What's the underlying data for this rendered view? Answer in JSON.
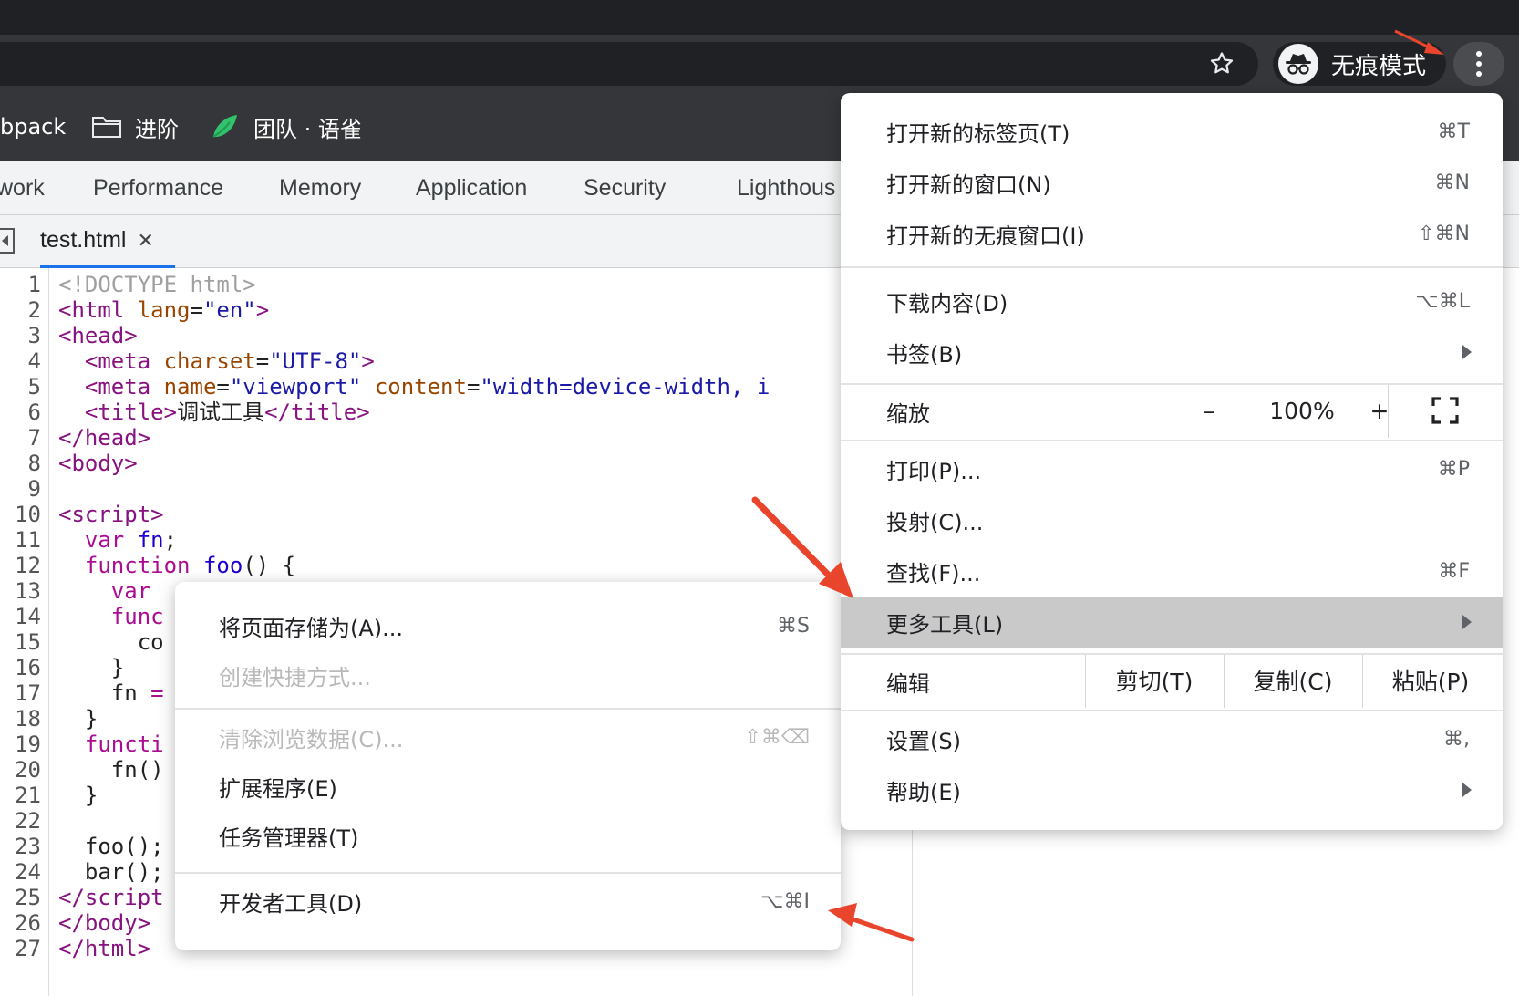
{
  "browser": {
    "incognito_label": "无痕模式",
    "icons": [
      "star-icon",
      "incognito-icon",
      "kebab-menu-icon"
    ]
  },
  "bookmarks": [
    {
      "label": "bpack",
      "icon": ""
    },
    {
      "label": "进阶",
      "icon": "folder-icon"
    },
    {
      "label": "团队 · 语雀",
      "icon": "yuque-logo-icon"
    }
  ],
  "devtools": {
    "tabs": [
      "work",
      "Performance",
      "Memory",
      "Application",
      "Security",
      "Lighthous"
    ],
    "file_tab": "test.html",
    "code_lines": [
      {
        "n": "1",
        "parts": [
          [
            "doc",
            "<!DOCTYPE html>"
          ]
        ]
      },
      {
        "n": "2",
        "parts": [
          [
            "tag",
            "<html "
          ],
          [
            "attr",
            "lang"
          ],
          [
            "plain",
            "="
          ],
          [
            "val",
            "\"en\""
          ],
          [
            "tag",
            ">"
          ]
        ]
      },
      {
        "n": "3",
        "parts": [
          [
            "tag",
            "<head>"
          ]
        ]
      },
      {
        "n": "4",
        "parts": [
          [
            "plain",
            "  "
          ],
          [
            "tag",
            "<meta "
          ],
          [
            "attr",
            "charset"
          ],
          [
            "plain",
            "="
          ],
          [
            "val",
            "\"UTF-8\""
          ],
          [
            "tag",
            ">"
          ]
        ]
      },
      {
        "n": "5",
        "parts": [
          [
            "plain",
            "  "
          ],
          [
            "tag",
            "<meta "
          ],
          [
            "attr",
            "name"
          ],
          [
            "plain",
            "="
          ],
          [
            "val",
            "\"viewport\""
          ],
          [
            "plain",
            " "
          ],
          [
            "attr",
            "content"
          ],
          [
            "plain",
            "="
          ],
          [
            "val",
            "\"width=device-width, i"
          ]
        ]
      },
      {
        "n": "6",
        "parts": [
          [
            "plain",
            "  "
          ],
          [
            "tag",
            "<title>"
          ],
          [
            "plain",
            "调试工具"
          ],
          [
            "tag",
            "</title>"
          ]
        ]
      },
      {
        "n": "7",
        "parts": [
          [
            "tag",
            "</head>"
          ]
        ]
      },
      {
        "n": "8",
        "parts": [
          [
            "tag",
            "<body>"
          ]
        ]
      },
      {
        "n": "9",
        "parts": []
      },
      {
        "n": "10",
        "parts": [
          [
            "tag",
            "<script>"
          ]
        ]
      },
      {
        "n": "11",
        "parts": [
          [
            "plain",
            "  "
          ],
          [
            "kw",
            "var"
          ],
          [
            "plain",
            " "
          ],
          [
            "fn",
            "fn"
          ],
          [
            "plain",
            ";"
          ]
        ]
      },
      {
        "n": "12",
        "parts": [
          [
            "plain",
            "  "
          ],
          [
            "kw",
            "function"
          ],
          [
            "plain",
            " "
          ],
          [
            "fn",
            "foo"
          ],
          [
            "plain",
            "() {"
          ]
        ]
      },
      {
        "n": "13",
        "parts": [
          [
            "plain",
            "    "
          ],
          [
            "kw",
            "var"
          ]
        ]
      },
      {
        "n": "14",
        "parts": [
          [
            "plain",
            "    "
          ],
          [
            "kw",
            "func"
          ]
        ]
      },
      {
        "n": "15",
        "parts": [
          [
            "plain",
            "      co"
          ]
        ]
      },
      {
        "n": "16",
        "parts": [
          [
            "plain",
            "    }"
          ]
        ]
      },
      {
        "n": "17",
        "parts": [
          [
            "plain",
            "    fn "
          ],
          [
            "kw",
            "="
          ]
        ]
      },
      {
        "n": "18",
        "parts": [
          [
            "plain",
            "  }"
          ]
        ]
      },
      {
        "n": "19",
        "parts": [
          [
            "plain",
            "  "
          ],
          [
            "kw",
            "functi"
          ]
        ]
      },
      {
        "n": "20",
        "parts": [
          [
            "plain",
            "    fn()"
          ]
        ]
      },
      {
        "n": "21",
        "parts": [
          [
            "plain",
            "  }"
          ]
        ]
      },
      {
        "n": "22",
        "parts": []
      },
      {
        "n": "23",
        "parts": [
          [
            "plain",
            "  foo();"
          ]
        ]
      },
      {
        "n": "24",
        "parts": [
          [
            "plain",
            "  bar();"
          ]
        ]
      },
      {
        "n": "25",
        "parts": [
          [
            "tag",
            "</script"
          ]
        ]
      },
      {
        "n": "26",
        "parts": [
          [
            "tag",
            "</body>"
          ]
        ]
      },
      {
        "n": "27",
        "parts": [
          [
            "tag",
            "</html>"
          ]
        ]
      }
    ]
  },
  "main_menu": {
    "new_tab": {
      "label": "打开新的标签页(T)",
      "shortcut": "⌘T"
    },
    "new_window": {
      "label": "打开新的窗口(N)",
      "shortcut": "⌘N"
    },
    "new_incognito": {
      "label": "打开新的无痕窗口(I)",
      "shortcut": "⇧⌘N"
    },
    "downloads": {
      "label": "下载内容(D)",
      "shortcut": "⌥⌘L"
    },
    "bookmarks": {
      "label": "书签(B)"
    },
    "zoom": {
      "label": "缩放",
      "minus": "–",
      "value": "100%",
      "plus": "+"
    },
    "print": {
      "label": "打印(P)...",
      "shortcut": "⌘P"
    },
    "cast": {
      "label": "投射(C)..."
    },
    "find": {
      "label": "查找(F)...",
      "shortcut": "⌘F"
    },
    "more_tools": {
      "label": "更多工具(L)"
    },
    "edit": {
      "label": "编辑",
      "cut": "剪切(T)",
      "copy": "复制(C)",
      "paste": "粘贴(P)"
    },
    "settings": {
      "label": "设置(S)",
      "shortcut": "⌘,"
    },
    "help": {
      "label": "帮助(E)"
    }
  },
  "sub_menu": {
    "save_page": {
      "label": "将页面存储为(A)...",
      "shortcut": "⌘S"
    },
    "create_shortcut": {
      "label": "创建快捷方式..."
    },
    "clear_data": {
      "label": "清除浏览数据(C)...",
      "shortcut": "⇧⌘⌫"
    },
    "extensions": {
      "label": "扩展程序(E)"
    },
    "task_manager": {
      "label": "任务管理器(T)"
    },
    "dev_tools": {
      "label": "开发者工具(D)",
      "shortcut": "⌥⌘I"
    }
  },
  "colors": {
    "annotation_arrow": "#e8452c",
    "highlight": "#c9c9c9",
    "toolbar": "#35363a"
  }
}
